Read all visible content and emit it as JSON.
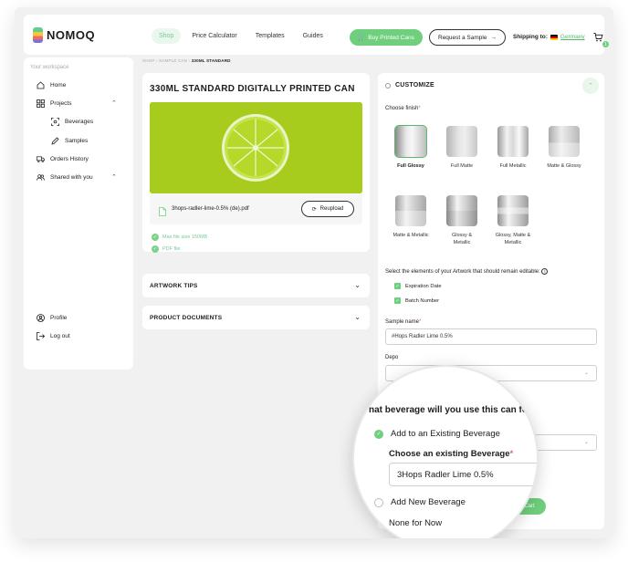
{
  "brand": {
    "name": "NOMOQ"
  },
  "nav": {
    "items": [
      "Shop",
      "Price Calculator",
      "Templates",
      "Guides"
    ]
  },
  "header": {
    "buy_label": "Buy Printed Cans",
    "sample_label": "Request a Sample",
    "shipping_label": "Shipping to:",
    "shipping_country": "Germany",
    "cart_count": "1"
  },
  "sidebar": {
    "workspace_label": "Your workspace",
    "items": [
      {
        "label": "Home",
        "icon": "home-icon"
      },
      {
        "label": "Projects",
        "icon": "grid-icon"
      },
      {
        "label": "Beverages",
        "icon": "scan-icon"
      },
      {
        "label": "Samples",
        "icon": "pen-icon"
      },
      {
        "label": "Orders History",
        "icon": "truck-icon"
      },
      {
        "label": "Shared with you",
        "icon": "users-icon"
      },
      {
        "label": "Profile",
        "icon": "user-circle-icon"
      },
      {
        "label": "Log out",
        "icon": "logout-icon"
      }
    ]
  },
  "breadcrumb": {
    "parts": [
      "SHOP",
      "SAMPLE CAN"
    ],
    "current": "330ML STANDARD"
  },
  "product": {
    "title": "330ML STANDARD DIGITALLY PRINTED CAN",
    "file_name": "3hops-radler-lime-0.5% (de).pdf",
    "reupload_label": "Reupload",
    "notes": [
      "Max file size 150MB",
      "PDF file"
    ]
  },
  "accordions": [
    "ARTWORK TIPS",
    "PRODUCT DOCUMENTS"
  ],
  "customize": {
    "title": "CUSTOMIZE",
    "finish_label": "Choose finish",
    "finishes": [
      "Full Glossy",
      "Full Matte",
      "Full Metallic",
      "Matte & Glossy",
      "Matte & Metallic",
      "Glossy & Metallic",
      "Glossy, Matte & Metallic"
    ],
    "selected_finish": "Full Glossy",
    "editable_label": "Select the elements of your Artwork that should remain editable:",
    "editable_items": [
      "Expiration Date",
      "Batch Number"
    ],
    "sample_name_label": "Sample name",
    "sample_name_value": "#Hops Radler Lime 0.5%",
    "dropdown_partial_label": "Depo",
    "cart_button_partial": "Cart"
  },
  "magnifier": {
    "question": "nat beverage will you use this can for?",
    "option_existing": "Add to an Existing Beverage",
    "choose_label": "Choose an existing Beverage",
    "choose_value": "3Hops Radler Lime 0.5%",
    "option_new": "Add New Beverage",
    "none_label": "None for Now"
  },
  "colors": {
    "accent": "#6fcf7d",
    "lime": "#a8cc1d",
    "link": "#57b86a"
  }
}
